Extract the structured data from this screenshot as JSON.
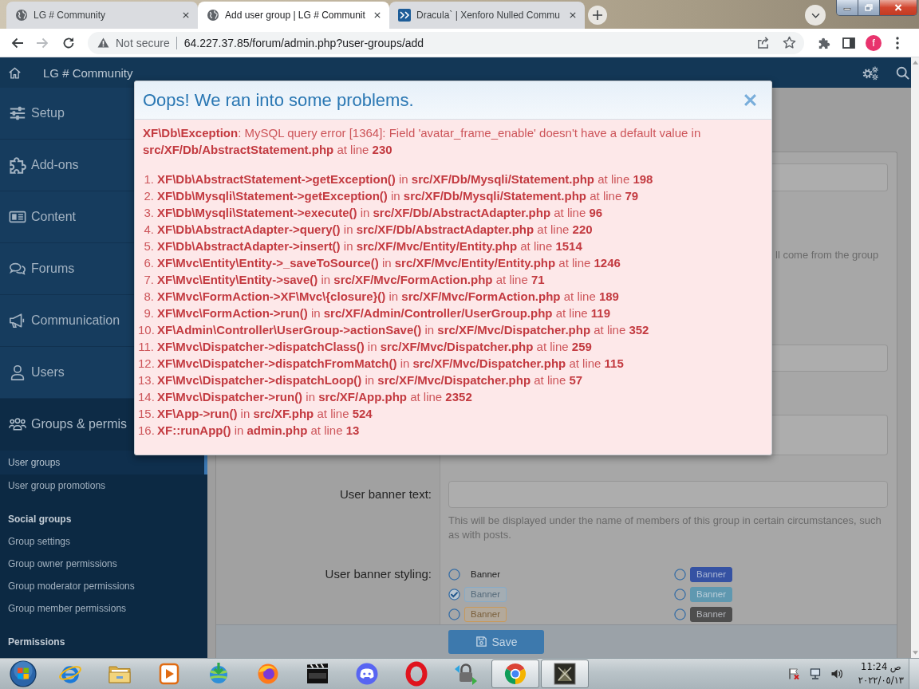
{
  "browser": {
    "tabs": [
      {
        "title": "LG # Community",
        "kind": "page",
        "selected": false
      },
      {
        "title": "Add user group | LG # Communit",
        "kind": "page",
        "selected": true
      },
      {
        "title": "Dracula` | Xenforo Nulled Commu",
        "kind": "favicon",
        "selected": false
      }
    ],
    "back": {
      "disabled": false
    },
    "forward": {
      "disabled": true
    },
    "address_bar": {
      "security_label": "Not secure",
      "url": "64.227.37.85/forum/admin.php?user-groups/add"
    },
    "profile": {
      "initial": "f"
    }
  },
  "site_header": {
    "title": "LG # Community"
  },
  "sidebar": {
    "nav": [
      {
        "label": "Setup",
        "expanded": false
      },
      {
        "label": "Add-ons",
        "expanded": false
      },
      {
        "label": "Content",
        "expanded": false
      },
      {
        "label": "Forums",
        "expanded": false
      },
      {
        "label": "Communication",
        "expanded": false
      },
      {
        "label": "Users",
        "expanded": false
      },
      {
        "label": "Groups & permis",
        "expanded": true,
        "children": [
          {
            "kind": "link",
            "label": "User groups",
            "selected": true
          },
          {
            "kind": "link",
            "label": "User group promotions",
            "selected": false
          },
          {
            "kind": "heading",
            "label": "Social groups"
          },
          {
            "kind": "link",
            "label": "Group settings",
            "selected": false
          },
          {
            "kind": "link",
            "label": "Group owner permissions",
            "selected": false
          },
          {
            "kind": "link",
            "label": "Group moderator permissions",
            "selected": false
          },
          {
            "kind": "link",
            "label": "Group member permissions",
            "selected": false
          },
          {
            "kind": "heading",
            "label": "Permissions"
          }
        ]
      }
    ]
  },
  "form": {
    "rows": [
      {
        "kind": "input"
      },
      {
        "kind": "note",
        "text": "ll come from the group"
      },
      {
        "kind": "input"
      },
      {
        "kind": "textarea"
      },
      {
        "kind": "input",
        "label": "User banner text:",
        "help": "This will be displayed under the name of members of this group in certain circumstances, such as with posts."
      },
      {
        "kind": "radios",
        "label": "User banner styling:",
        "options": [
          {
            "label": "Banner",
            "kind": "plain",
            "selected": false
          },
          {
            "label": "Banner",
            "kind": "solid",
            "color": "#3552a3",
            "selected": false
          },
          {
            "label": "Banner",
            "kind": "outline",
            "color": "#86abc8",
            "selected": true
          },
          {
            "label": "Banner",
            "kind": "solid",
            "color": "#5f98b0",
            "selected": false
          },
          {
            "label": "Banner",
            "kind": "outline",
            "color": "#c8995a",
            "selected": false
          },
          {
            "label": "Banner",
            "kind": "solid",
            "color": "#4e4e4e",
            "selected": false
          }
        ]
      }
    ],
    "submit": {
      "label": "Save"
    }
  },
  "error_dialog": {
    "title": "Oops! We ran into some problems.",
    "message": "**XF\\Db\\Exception**: MySQL query error [1364]: Field 'avatar_frame_enable' doesn't have a default value in **src/XF/Db/AbstractStatement.php** at line **230**",
    "trace": [
      {
        "number": "1.",
        "text": "**XF\\Db\\AbstractStatement->getException()** in **src/XF/Db/Mysqli/Statement.php** at line **198**"
      },
      {
        "number": "2.",
        "text": "**XF\\Db\\Mysqli\\Statement->getException()** in **src/XF/Db/Mysqli/Statement.php** at line **79**"
      },
      {
        "number": "3.",
        "text": "**XF\\Db\\Mysqli\\Statement->execute()** in **src/XF/Db/AbstractAdapter.php** at line **96**"
      },
      {
        "number": "4.",
        "text": "**XF\\Db\\AbstractAdapter->query()** in **src/XF/Db/AbstractAdapter.php** at line **220**"
      },
      {
        "number": "5.",
        "text": "**XF\\Db\\AbstractAdapter->insert()** in **src/XF/Mvc/Entity/Entity.php** at line **1514**"
      },
      {
        "number": "6.",
        "text": "**XF\\Mvc\\Entity\\Entity->_saveToSource()** in **src/XF/Mvc/Entity/Entity.php** at line **1246**"
      },
      {
        "number": "7.",
        "text": "**XF\\Mvc\\Entity\\Entity->save()** in **src/XF/Mvc/FormAction.php** at line **71**"
      },
      {
        "number": "8.",
        "text": "**XF\\Mvc\\FormAction->XF\\Mvc\\{closure}()** in **src/XF/Mvc/FormAction.php** at line **189**"
      },
      {
        "number": "9.",
        "text": "**XF\\Mvc\\FormAction->run()** in **src/XF/Admin/Controller/UserGroup.php** at line **119**"
      },
      {
        "number": "10.",
        "text": "**XF\\Admin\\Controller\\UserGroup->actionSave()** in **src/XF/Mvc/Dispatcher.php** at line **352**"
      },
      {
        "number": "11.",
        "text": "**XF\\Mvc\\Dispatcher->dispatchClass()** in **src/XF/Mvc/Dispatcher.php** at line **259**"
      },
      {
        "number": "12.",
        "text": "**XF\\Mvc\\Dispatcher->dispatchFromMatch()** in **src/XF/Mvc/Dispatcher.php** at line **115**"
      },
      {
        "number": "13.",
        "text": "**XF\\Mvc\\Dispatcher->dispatchLoop()** in **src/XF/Mvc/Dispatcher.php** at line **57**"
      },
      {
        "number": "14.",
        "text": "**XF\\Mvc\\Dispatcher->run()** in **src/XF/App.php** at line **2352**"
      },
      {
        "number": "15.",
        "text": "**XF\\App->run()** in **src/XF.php** at line **524**"
      },
      {
        "number": "16.",
        "text": "**XF::runApp()** in **admin.php** at line **13**"
      }
    ]
  },
  "taskbar": {
    "apps": [
      {
        "open": false
      },
      {
        "open": false
      },
      {
        "open": false
      },
      {
        "open": false
      },
      {
        "open": false
      },
      {
        "open": false
      },
      {
        "open": false
      },
      {
        "open": false
      },
      {
        "open": false
      },
      {
        "open": true
      },
      {
        "open": true
      }
    ],
    "clock": {
      "time": "11:24 ص",
      "date": "٢٠٢٢/٠٥/١٣"
    }
  }
}
